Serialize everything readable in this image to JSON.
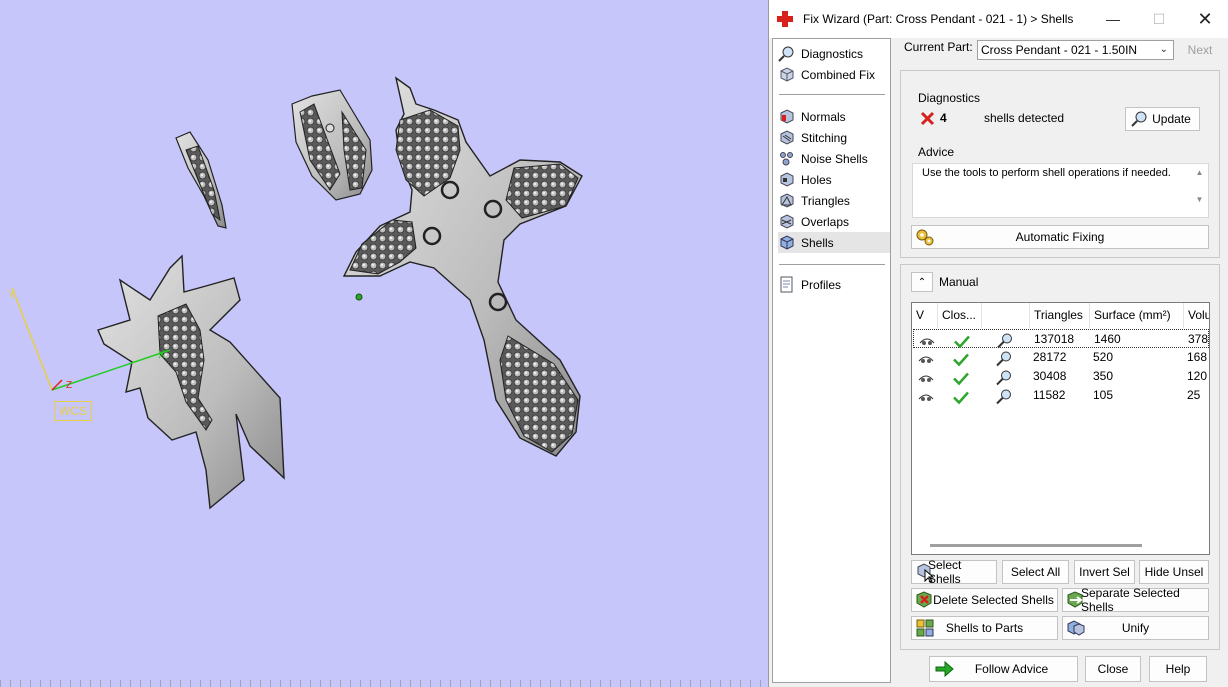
{
  "window": {
    "title": "Fix Wizard (Part: Cross Pendant - 021 - 1) > Shells"
  },
  "viewport": {
    "wcs_label": "WCS",
    "axis_labels": {
      "x": "X",
      "y": "Y",
      "z": "Z"
    }
  },
  "nav": {
    "items": [
      {
        "label": "Diagnostics",
        "icon": "magnifier-icon"
      },
      {
        "label": "Combined Fix",
        "icon": "cube-icon"
      },
      {
        "label": "Normals",
        "icon": "normals-icon"
      },
      {
        "label": "Stitching",
        "icon": "stitching-icon"
      },
      {
        "label": "Noise Shells",
        "icon": "noise-shells-icon"
      },
      {
        "label": "Holes",
        "icon": "holes-icon"
      },
      {
        "label": "Triangles",
        "icon": "triangles-icon"
      },
      {
        "label": "Overlaps",
        "icon": "overlaps-icon"
      },
      {
        "label": "Shells",
        "icon": "shells-icon",
        "selected": true
      },
      {
        "label": "Profiles",
        "icon": "profiles-icon"
      }
    ]
  },
  "header": {
    "current_part_label": "Current Part:",
    "current_part_value": "Cross Pendant - 021 - 1.50IN",
    "next_label": "Next"
  },
  "diagnostics": {
    "title": "Diagnostics",
    "count": "4",
    "status_text": "shells detected",
    "update_label": "Update"
  },
  "advice": {
    "title": "Advice",
    "text": "Use the tools to perform shell operations if needed.",
    "auto_fix_label": "Automatic Fixing"
  },
  "manual": {
    "title": "Manual",
    "columns": [
      "V",
      "Clos...",
      "",
      "Triangles",
      "Surface (mm²)",
      "Volu"
    ],
    "rows": [
      {
        "triangles": "137018",
        "surface": "1460",
        "volume": "378"
      },
      {
        "triangles": "28172",
        "surface": "520",
        "volume": "168"
      },
      {
        "triangles": "30408",
        "surface": "350",
        "volume": "120"
      },
      {
        "triangles": "11582",
        "surface": "105",
        "volume": "25"
      }
    ],
    "buttons": {
      "select_shells": "Select Shells",
      "select_all": "Select All",
      "invert_sel": "Invert Sel",
      "hide_unsel": "Hide Unsel",
      "delete_selected": "Delete Selected Shells",
      "separate_selected": "Separate Selected Shells",
      "shells_to_parts": "Shells to Parts",
      "unify": "Unify"
    }
  },
  "footer": {
    "follow_advice": "Follow Advice",
    "close": "Close",
    "help": "Help"
  },
  "colors": {
    "viewport_bg": "#c6c6fb",
    "accent_red": "#d9211c",
    "check_green": "#2fa52f",
    "follow_arrow": "#26a826"
  }
}
